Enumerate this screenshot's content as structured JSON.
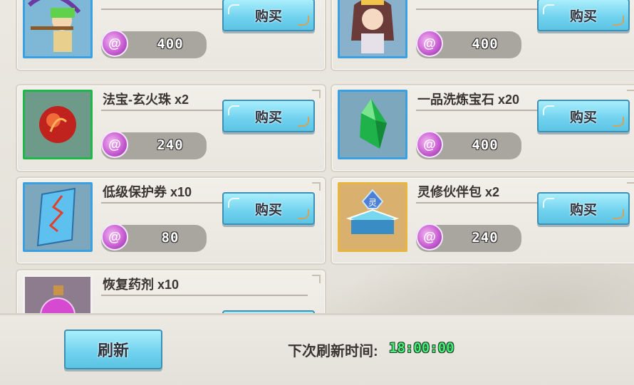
{
  "currency_icon": "purple-swirl-gem-icon",
  "buy_label": "购买",
  "shop": {
    "items": [
      {
        "name": "",
        "price": "400",
        "icon": "archer-character-icon"
      },
      {
        "name": "",
        "price": "400",
        "icon": "dancer-character-icon"
      },
      {
        "name": "法宝-玄火珠 x2",
        "price": "240",
        "icon": "red-fire-orb-icon"
      },
      {
        "name": "一品洗炼宝石 x20",
        "price": "400",
        "icon": "green-crystal-icon"
      },
      {
        "name": "低级保护券 x10",
        "price": "80",
        "icon": "blue-scroll-icon"
      },
      {
        "name": "灵修伙伴包 x2",
        "price": "240",
        "icon": "spirit-chest-icon"
      },
      {
        "name": "恢复药剂 x10",
        "price": "",
        "icon": "potion-bottle-icon"
      }
    ]
  },
  "footer": {
    "refresh_label": "刷新",
    "next_refresh_label": "下次刷新时间:",
    "next_refresh_time": "18:00:00"
  },
  "colors": {
    "button": "#6fd1ee",
    "timer": "#44f07a",
    "price_pill": "#a9a59f",
    "frame_blue": "#3aa0df",
    "frame_green": "#1fb64a",
    "frame_gold": "#e6b640"
  }
}
